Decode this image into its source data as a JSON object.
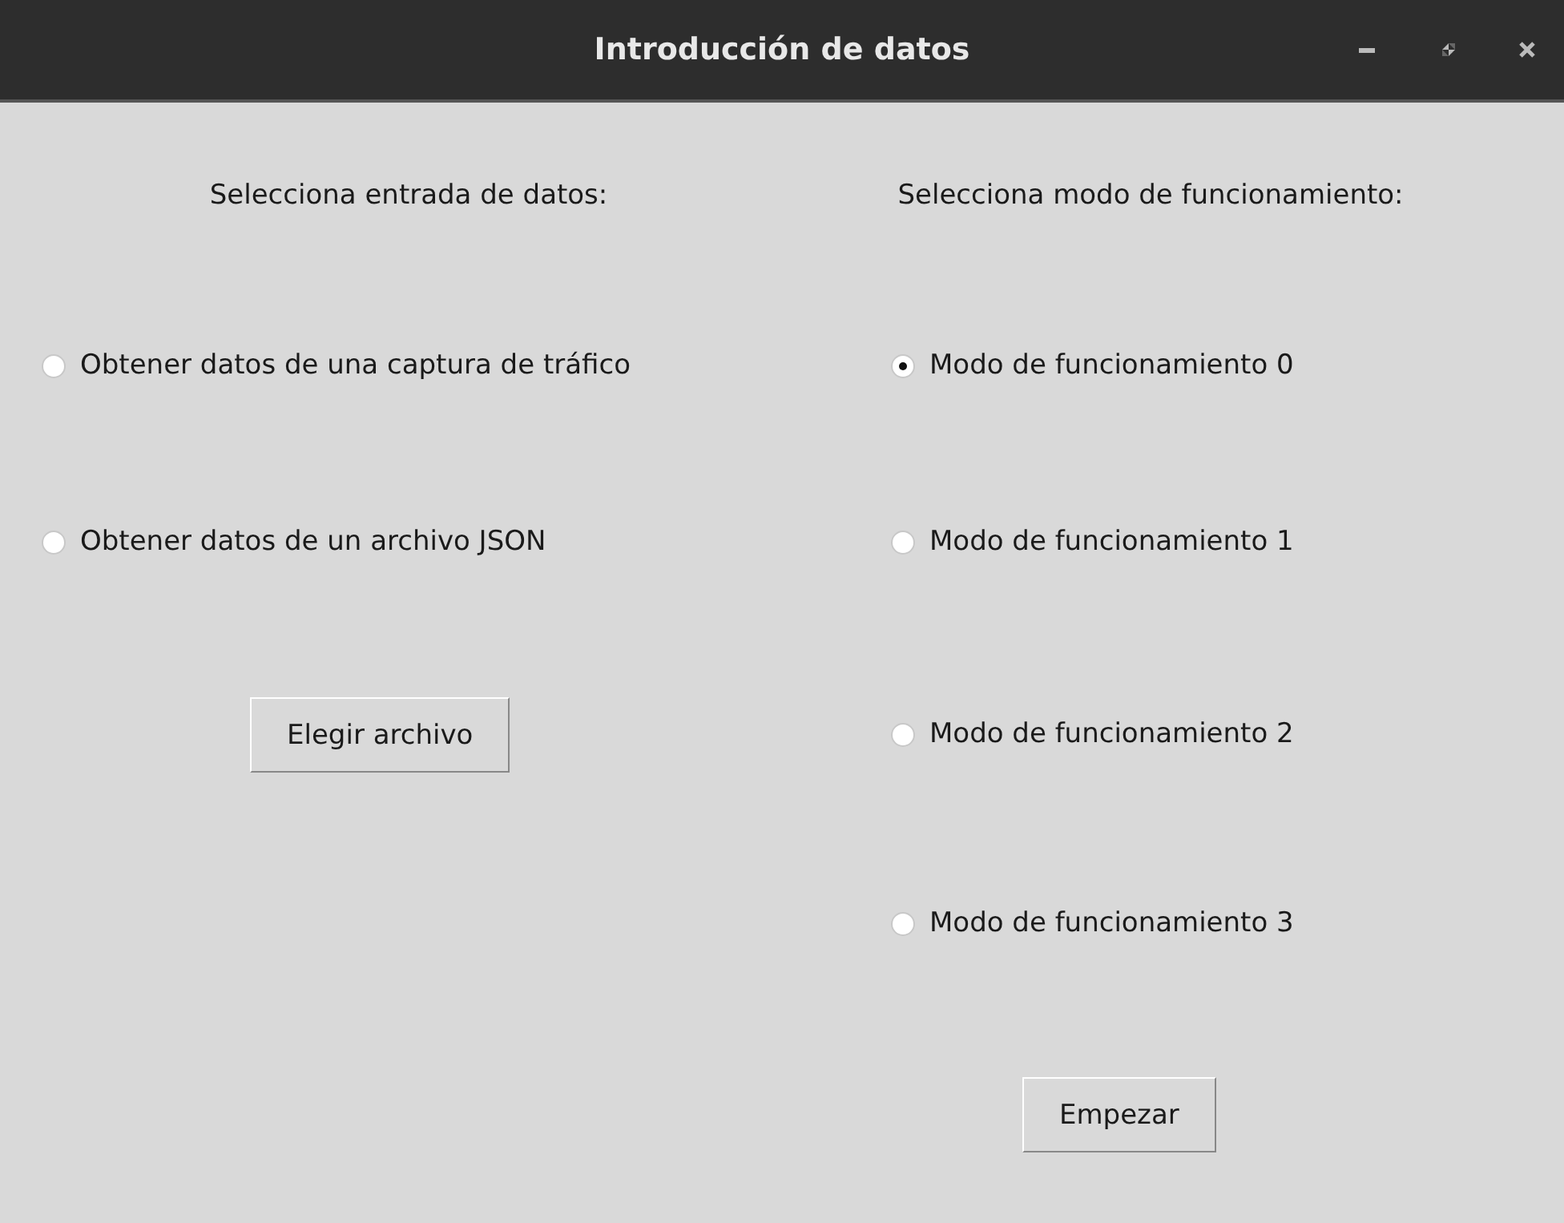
{
  "window": {
    "title": "Introducción de datos"
  },
  "input_panel": {
    "heading": "Selecciona entrada de datos:",
    "options": [
      {
        "label": "Obtener datos de una captura de tráfico",
        "selected": false
      },
      {
        "label": "Obtener datos de un archivo JSON",
        "selected": false
      }
    ],
    "button": "Elegir archivo"
  },
  "mode_panel": {
    "heading": "Selecciona modo de funcionamiento:",
    "options": [
      {
        "label": "Modo de funcionamiento 0",
        "selected": true
      },
      {
        "label": "Modo de funcionamiento 1",
        "selected": false
      },
      {
        "label": "Modo de funcionamiento 2",
        "selected": false
      },
      {
        "label": "Modo de funcionamiento 3",
        "selected": false
      }
    ],
    "button": "Empezar"
  }
}
